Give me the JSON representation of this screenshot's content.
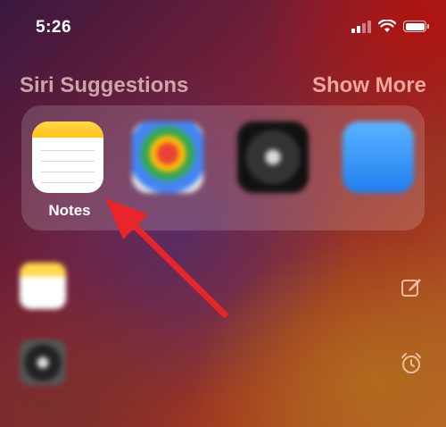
{
  "status_bar": {
    "time": "5:26"
  },
  "header": {
    "title": "Siri Suggestions",
    "link": "Show More"
  },
  "apps": [
    {
      "label": "Notes",
      "icon": "notes-app-icon"
    },
    {
      "label": "",
      "icon": "maps-app-icon"
    },
    {
      "label": "",
      "icon": "clock-app-icon"
    },
    {
      "label": "",
      "icon": "mail-app-icon"
    }
  ],
  "list": [
    {
      "text": "",
      "icon": "notes-app-icon",
      "action_icon": "compose-icon"
    },
    {
      "text": "",
      "icon": "clock-app-icon",
      "action_icon": "alarm-icon"
    }
  ],
  "colors": {
    "annotation_arrow": "#e8262a",
    "notes_yellow": "#ffc21a"
  }
}
